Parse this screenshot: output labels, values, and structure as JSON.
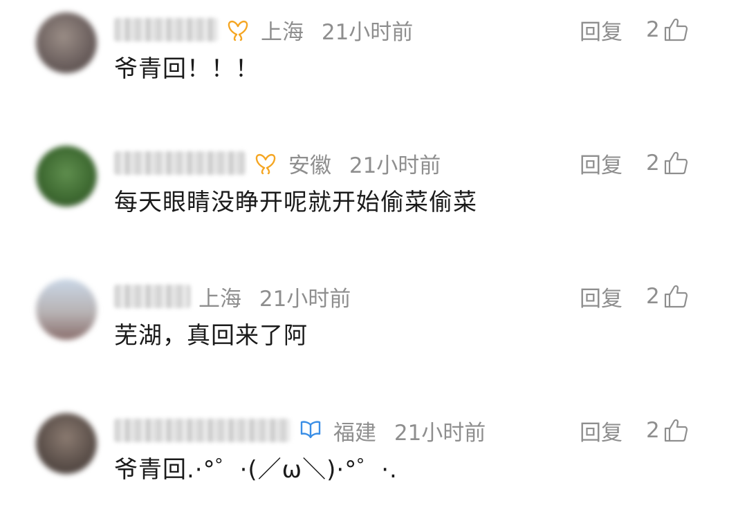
{
  "comments": [
    {
      "username": "",
      "badge": {
        "icon": "butterfly-icon",
        "color": "#f5a623"
      },
      "location": "上海",
      "time": "21小时前",
      "reply_label": "回复",
      "likes": "2",
      "text": "爷青回！！！"
    },
    {
      "username": "",
      "badge": {
        "icon": "butterfly-icon",
        "color": "#f5a623"
      },
      "location": "安徽",
      "time": "21小时前",
      "reply_label": "回复",
      "likes": "2",
      "text": "每天眼睛没睁开呢就开始偷菜偷菜"
    },
    {
      "username": "",
      "badge": null,
      "location": "上海",
      "time": "21小时前",
      "reply_label": "回复",
      "likes": "2",
      "text": "芜湖，真回来了阿"
    },
    {
      "username": "",
      "badge": {
        "icon": "shield-icon",
        "color": "#3a8ee6"
      },
      "location": "福建",
      "time": "21小时前",
      "reply_label": "回复",
      "likes": "2",
      "text": "爷青回.·°゜·(／ω＼)·°゜·."
    }
  ]
}
